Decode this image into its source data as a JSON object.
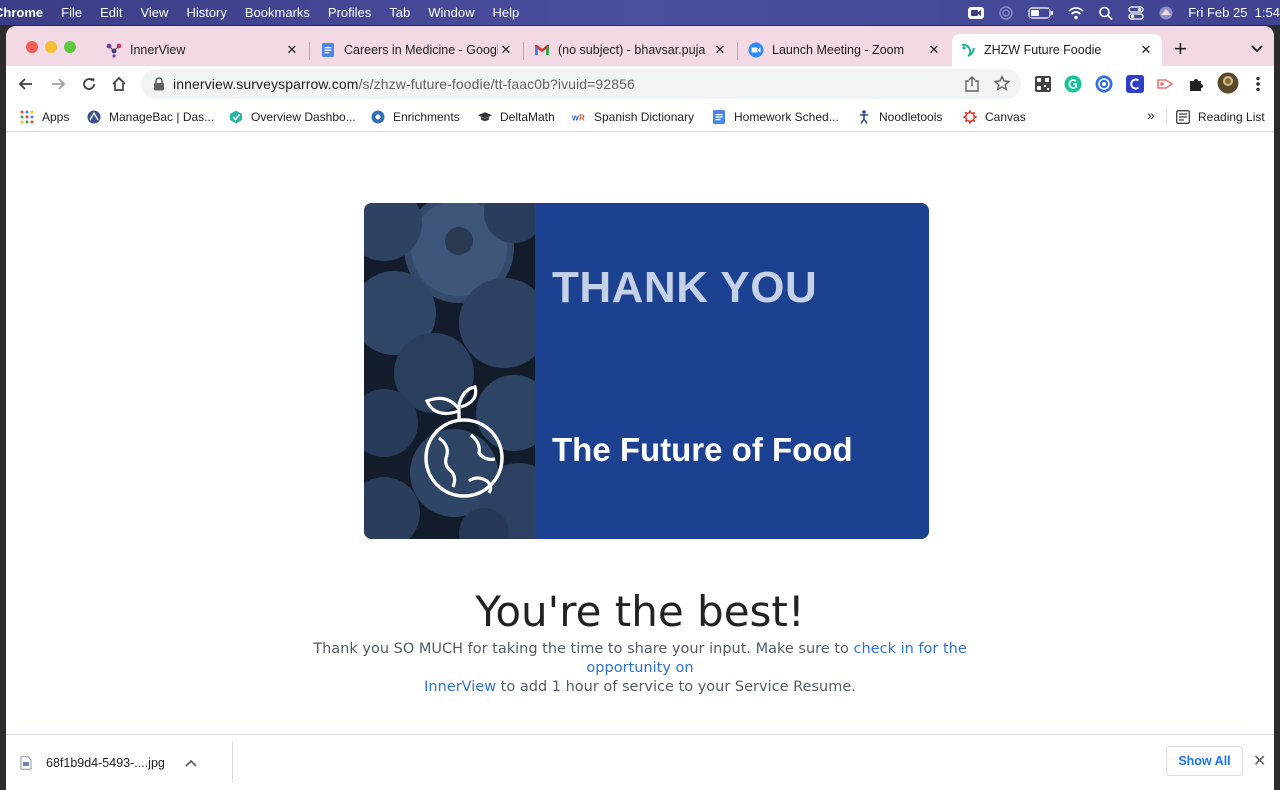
{
  "menubar": {
    "app": "Chrome",
    "items": [
      "File",
      "Edit",
      "View",
      "History",
      "Bookmarks",
      "Profiles",
      "Tab",
      "Window",
      "Help"
    ],
    "clock": "Fri Feb 25  1:54"
  },
  "tabs": [
    {
      "title": "InnerView",
      "icon": "innerview-icon"
    },
    {
      "title": "Careers in Medicine - Googl",
      "icon": "google-docs-icon"
    },
    {
      "title": "(no subject) - bhavsar.puja",
      "icon": "gmail-icon"
    },
    {
      "title": "Launch Meeting - Zoom",
      "icon": "zoom-icon"
    },
    {
      "title": "ZHZW Future Foodie",
      "icon": "surveysparrow-icon",
      "active": true
    }
  ],
  "address": {
    "host": "innerview.surveysparrow.com",
    "path": "/s/zhzw-future-foodie/tt-faac0b?ivuid=92856"
  },
  "bookmarks": [
    {
      "label": "Apps",
      "icon": "apps-grid-icon"
    },
    {
      "label": "ManageBac | Das...",
      "icon": "managebac-icon"
    },
    {
      "label": "Overview Dashbo...",
      "icon": "overview-icon"
    },
    {
      "label": "Enrichments",
      "icon": "enrichments-icon"
    },
    {
      "label": "DeltaMath",
      "icon": "graduation-cap-icon"
    },
    {
      "label": "Spanish Dictionary",
      "icon": "wordreference-icon"
    },
    {
      "label": "Homework Sched...",
      "icon": "google-docs-icon"
    },
    {
      "label": "Noodletools",
      "icon": "noodletools-icon"
    },
    {
      "label": "Canvas",
      "icon": "canvas-icon"
    }
  ],
  "bookmarks_overflow": "»",
  "reading_list": "Reading List",
  "banner": {
    "thank_you": "THANK YOU",
    "subtitle": "The Future of Food"
  },
  "headline": "You're the best!",
  "message": {
    "before_link": "Thank you SO MUCH for taking the time to share your input. Make sure to ",
    "link_line1": "check in for the opportunity on",
    "link_line2": "InnerView",
    "after_link": " to add 1 hour of service to your Service Resume."
  },
  "downloads": {
    "file": "68f1b9d4-5493-....jpg",
    "show_all": "Show All"
  },
  "colors": {
    "banner_blue": "#1c4191",
    "link_blue": "#2e72d2",
    "tab_strip": "#f2d9e3"
  }
}
